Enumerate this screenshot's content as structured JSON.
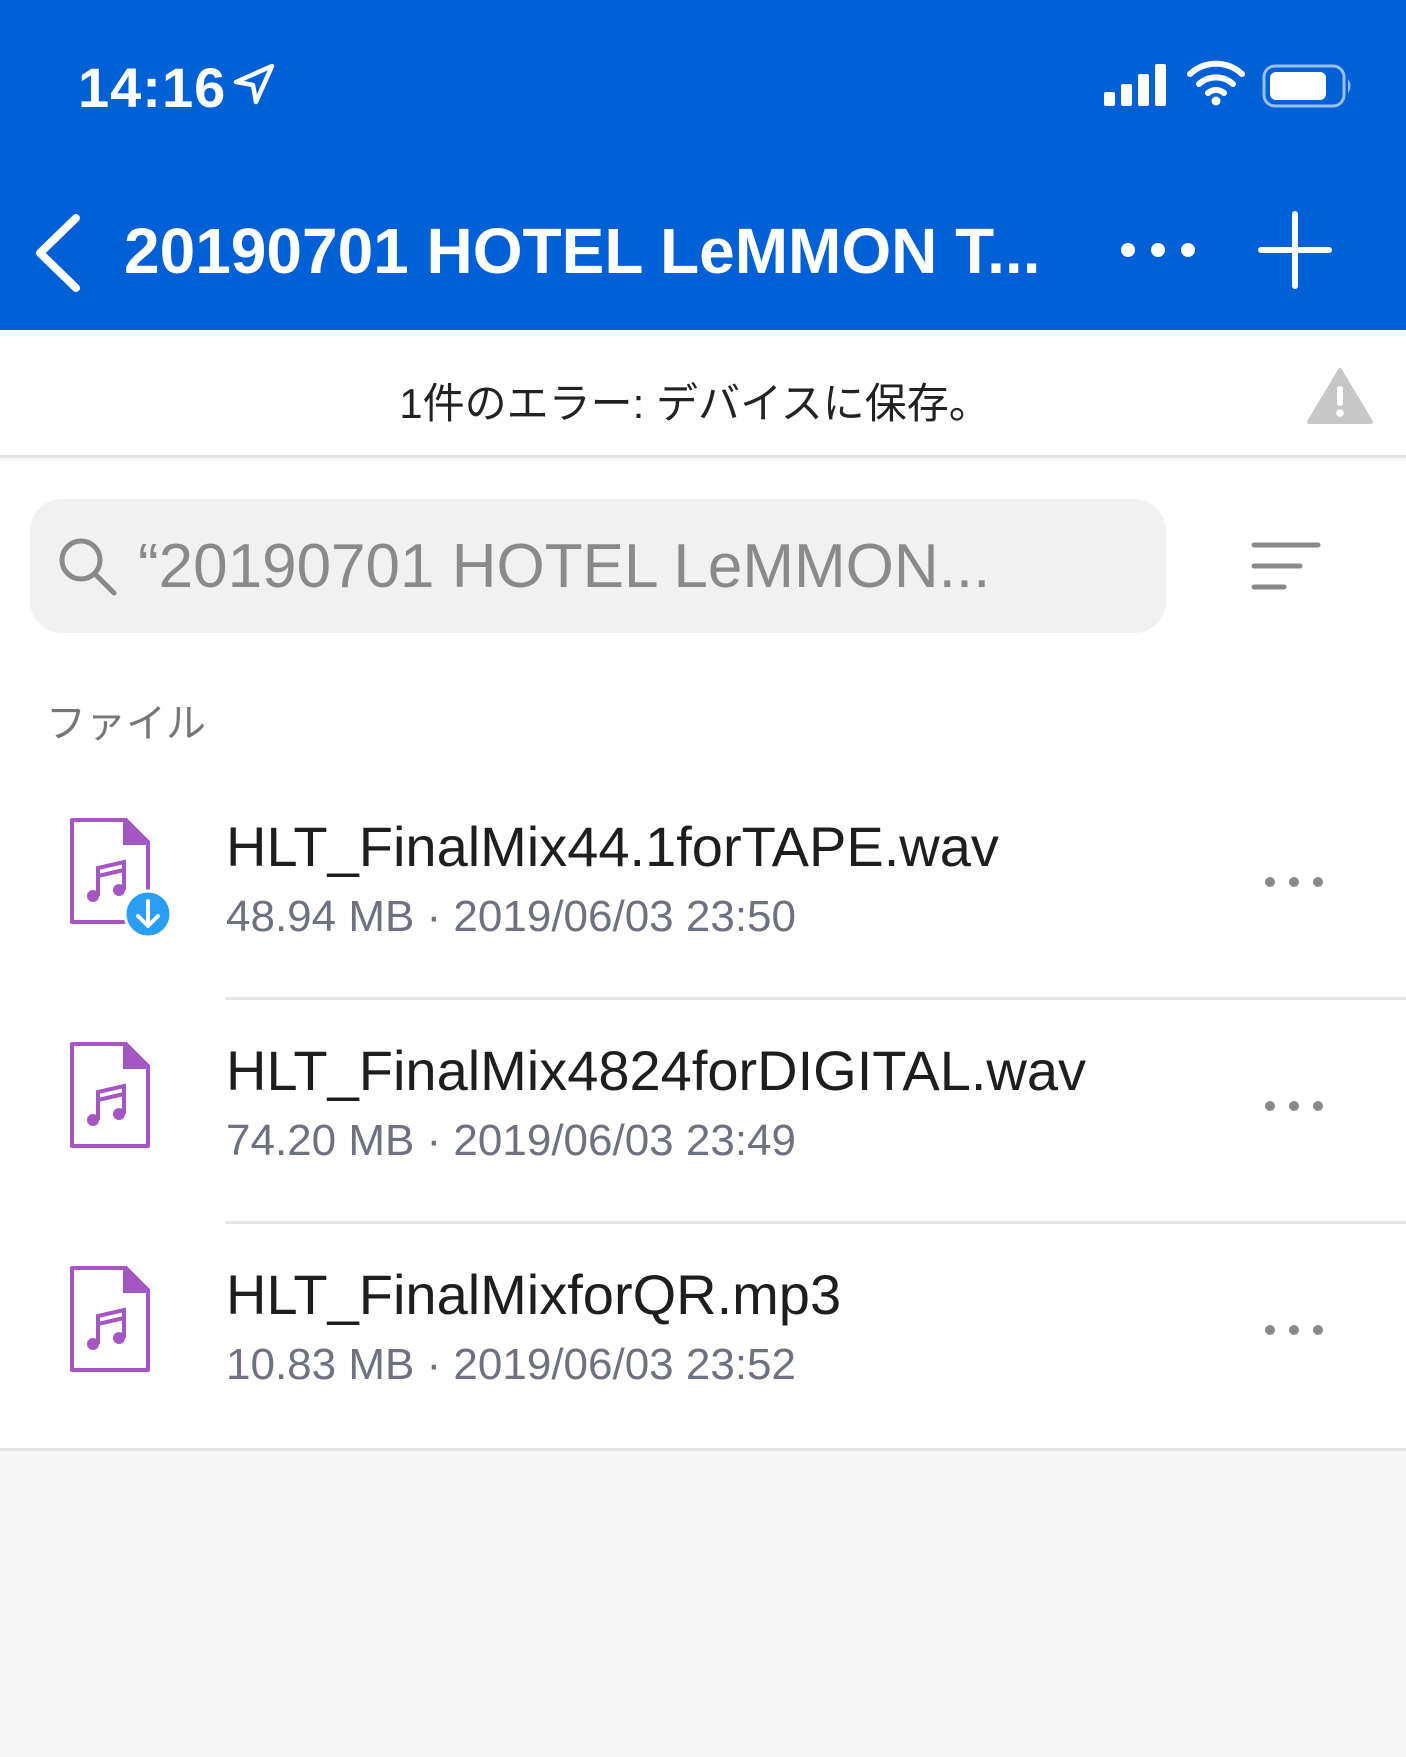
{
  "status_bar": {
    "time": "14:16"
  },
  "nav": {
    "title": "20190701 HOTEL LeMMON T..."
  },
  "error_banner": {
    "text": "1件のエラー: デバイスに保存。"
  },
  "search": {
    "placeholder": "“20190701 HOTEL LeMMON..."
  },
  "section": {
    "label": "ファイル"
  },
  "files": [
    {
      "name": "HLT_FinalMix44.1forTAPE.wav",
      "meta": "48.94 MB · 2019/06/03 23:50",
      "downloading": true
    },
    {
      "name": "HLT_FinalMix4824forDIGITAL.wav",
      "meta": "74.20 MB · 2019/06/03 23:49",
      "downloading": false
    },
    {
      "name": "HLT_FinalMixforQR.mp3",
      "meta": "10.83 MB · 2019/06/03 23:52",
      "downloading": false
    }
  ],
  "icons": {
    "location": "location-arrow-icon",
    "signal": "cellular-signal-icon",
    "wifi": "wifi-icon",
    "battery": "battery-icon",
    "back": "chevron-left-icon",
    "more": "more-horizontal-icon",
    "add": "plus-icon",
    "warning": "warning-triangle-icon",
    "search": "search-icon",
    "sort": "sort-icon",
    "audio_file": "audio-file-icon",
    "download": "download-badge-icon"
  },
  "colors": {
    "header_blue": "#0160d5",
    "file_icon_purple": "#a456c4",
    "download_badge": "#2a9df4",
    "meta_gray": "#6e7280"
  }
}
